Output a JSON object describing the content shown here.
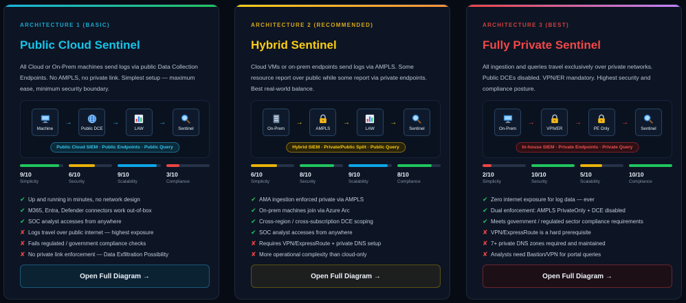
{
  "cards": [
    {
      "eyebrow": "ARCHITECTURE 1 (BASIC)",
      "title": "Public Cloud Sentinel",
      "description": "All Cloud or On-Prem machines send logs via public Data Collection Endpoints. No AMPLS, no private link. Simplest setup — maximum ease, minimum security boundary.",
      "accent": "#18b7de",
      "nodes": [
        {
          "label": "Machine",
          "icon": "computer-icon"
        },
        {
          "label": "Public DCE",
          "icon": "globe-icon"
        },
        {
          "label": "LAW",
          "icon": "bar-chart-icon"
        },
        {
          "label": "Sentinel",
          "icon": "magnifier-icon"
        }
      ],
      "pill": "Public Cloud SIEM · Public Endpoints · Public Query",
      "metrics": [
        {
          "score": "9/10",
          "label": "Simplicity",
          "value": 9,
          "color": "#22c55e"
        },
        {
          "score": "6/10",
          "label": "Security",
          "value": 6,
          "color": "#eab308"
        },
        {
          "score": "9/10",
          "label": "Scalability",
          "value": 9,
          "color": "#0ea5e9"
        },
        {
          "score": "3/10",
          "label": "Compliance",
          "value": 3,
          "color": "#ef4444"
        }
      ],
      "points": [
        {
          "type": "ok",
          "text": "Up and running in minutes, no network design"
        },
        {
          "type": "ok",
          "text": "M365, Entra, Defender connectors work out-of-box"
        },
        {
          "type": "ok",
          "text": "SOC analyst accesses from anywhere"
        },
        {
          "type": "no",
          "text": "Logs travel over public internet — highest exposure"
        },
        {
          "type": "no",
          "text": "Fails regulated / government compliance checks"
        },
        {
          "type": "no",
          "text": "No private link enforcement — Data Exfiltration Possibility"
        }
      ],
      "button": "Open Full Diagram →"
    },
    {
      "eyebrow": "ARCHITECTURE 2 (RECOMMENDED)",
      "title": "Hybrid Sentinel",
      "description": "Cloud VMs or on-prem endpoints send logs via AMPLS. Some resource report over public while some report via private endpoints. Best real-world balance.",
      "accent": "#facc15",
      "nodes": [
        {
          "label": "On-Prem",
          "icon": "server-icon"
        },
        {
          "label": "AMPLS",
          "icon": "lock-icon"
        },
        {
          "label": "LAW",
          "icon": "bar-chart-icon"
        },
        {
          "label": "Sentinel",
          "icon": "magnifier-icon"
        }
      ],
      "pill": "Hybrid SIEM · Private/Public Split · Public Query",
      "metrics": [
        {
          "score": "6/10",
          "label": "Simplicity",
          "value": 6,
          "color": "#eab308"
        },
        {
          "score": "8/10",
          "label": "Security",
          "value": 8,
          "color": "#22c55e"
        },
        {
          "score": "9/10",
          "label": "Scalability",
          "value": 9,
          "color": "#0ea5e9"
        },
        {
          "score": "8/10",
          "label": "Compliance",
          "value": 8,
          "color": "#22c55e"
        }
      ],
      "points": [
        {
          "type": "ok",
          "text": "AMA ingestion enforced private via AMPLS"
        },
        {
          "type": "ok",
          "text": "On-prem machines join via Azure Arc"
        },
        {
          "type": "ok",
          "text": "Cross-region / cross-subscription DCE scoping"
        },
        {
          "type": "ok",
          "text": "SOC analyst accesses from anywhere"
        },
        {
          "type": "no",
          "text": "Requires VPN/ExpressRoute + private DNS setup"
        },
        {
          "type": "no",
          "text": "More operational complexity than cloud-only"
        }
      ],
      "button": "Open Full Diagram →"
    },
    {
      "eyebrow": "ARCHITECTURE 3 (BEST)",
      "title": "Fully Private Sentinel",
      "description": "All ingestion and queries travel exclusively over private networks. Public DCEs disabled. VPN/ER mandatory. Highest security and compliance posture.",
      "accent": "#ef4444",
      "nodes": [
        {
          "label": "On-Prem",
          "icon": "computer-icon"
        },
        {
          "label": "VPN/ER",
          "icon": "lock-icon"
        },
        {
          "label": "PE Only",
          "icon": "lock-icon"
        },
        {
          "label": "Sentinel",
          "icon": "magnifier-icon"
        }
      ],
      "pill": "In-house SIEM · Private Endpoints · Private Query",
      "metrics": [
        {
          "score": "2/10",
          "label": "Simplicity",
          "value": 2,
          "color": "#ef4444"
        },
        {
          "score": "10/10",
          "label": "Security",
          "value": 10,
          "color": "#22c55e"
        },
        {
          "score": "5/10",
          "label": "Scalability",
          "value": 5,
          "color": "#eab308"
        },
        {
          "score": "10/10",
          "label": "Compliance",
          "value": 10,
          "color": "#22c55e"
        }
      ],
      "points": [
        {
          "type": "ok",
          "text": "Zero internet exposure for log data — ever"
        },
        {
          "type": "ok",
          "text": "Dual enforcement: AMPLS PrivateOnly + DCE disabled"
        },
        {
          "type": "ok",
          "text": "Meets government / regulated sector compliance requirements"
        },
        {
          "type": "no",
          "text": "VPN/ExpressRoute is a hard prerequisite"
        },
        {
          "type": "no",
          "text": "7+ private DNS zones required and maintained"
        },
        {
          "type": "no",
          "text": "Analysts need Bastion/VPN for portal queries"
        }
      ],
      "button": "Open Full Diagram →"
    }
  ]
}
